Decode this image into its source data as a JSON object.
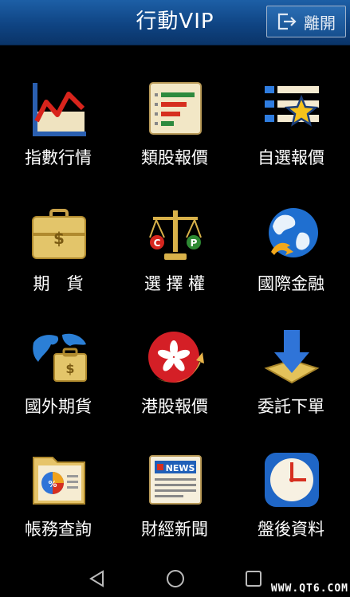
{
  "header": {
    "title": "行動VIP",
    "exit_label": "離開"
  },
  "menu": [
    {
      "label": "指數行情",
      "icon": "line-chart-icon"
    },
    {
      "label": "類股報價",
      "icon": "bar-report-icon"
    },
    {
      "label": "自選報價",
      "icon": "star-list-icon"
    },
    {
      "label": "期　貨",
      "icon": "briefcase-dollar-icon"
    },
    {
      "label": "選 擇 權",
      "icon": "balance-scale-icon"
    },
    {
      "label": "國際金融",
      "icon": "globe-icon"
    },
    {
      "label": "國外期貨",
      "icon": "world-briefcase-icon"
    },
    {
      "label": "港股報價",
      "icon": "hong-kong-flag-icon"
    },
    {
      "label": "委託下單",
      "icon": "download-arrow-icon"
    },
    {
      "label": "帳務查詢",
      "icon": "pie-folder-icon"
    },
    {
      "label": "財經新聞",
      "icon": "news-icon"
    },
    {
      "label": "盤後資料",
      "icon": "clock-icon"
    }
  ],
  "icon_text": {
    "call": "C",
    "put": "P",
    "news": "NEWS"
  },
  "watermark": "WWW.QT6.COM",
  "colors": {
    "header_top": "#1d5fa6",
    "header_bottom": "#0a3468",
    "background": "#000000"
  }
}
